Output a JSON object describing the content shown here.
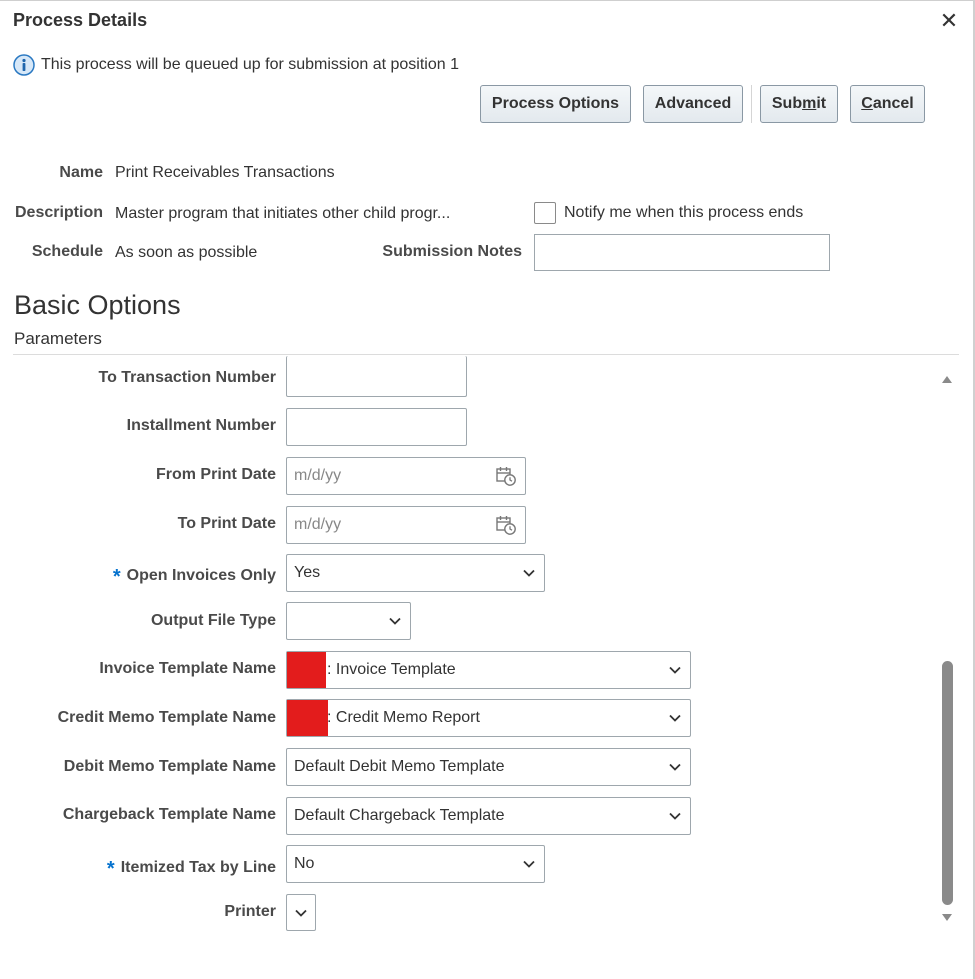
{
  "dialog": {
    "title": "Process Details",
    "info_text": "This process will be queued up for submission at position 1",
    "buttons": {
      "process_options": "Process Options",
      "advanced": "Advanced",
      "submit_pre": "Sub",
      "submit_mnemonic": "m",
      "submit_post": "it",
      "cancel_mnemonic": "C",
      "cancel_post": "ancel"
    }
  },
  "details": {
    "name_label": "Name",
    "name_value": "Print Receivables Transactions",
    "description_label": "Description",
    "description_value": "Master program that initiates other child progr...",
    "schedule_label": "Schedule",
    "schedule_value": "As soon as possible",
    "notify_label": "Notify me when this process ends",
    "notify_checked": false,
    "submission_notes_label": "Submission Notes",
    "submission_notes_value": ""
  },
  "sections": {
    "basic_options": "Basic Options",
    "parameters": "Parameters"
  },
  "parameters": {
    "to_transaction_number": {
      "label": "To Transaction Number",
      "value": ""
    },
    "installment_number": {
      "label": "Installment Number",
      "value": ""
    },
    "from_print_date": {
      "label": "From Print Date",
      "placeholder": "m/d/yy"
    },
    "to_print_date": {
      "label": "To Print Date",
      "placeholder": "m/d/yy"
    },
    "open_invoices_only": {
      "label": "Open Invoices Only",
      "required": "*",
      "value": "Yes"
    },
    "output_file_type": {
      "label": "Output File Type",
      "value": ""
    },
    "invoice_template_name": {
      "label": "Invoice Template Name",
      "value": ": Invoice Template"
    },
    "credit_memo_template_name": {
      "label": "Credit Memo Template Name",
      "value": ": Credit Memo Report"
    },
    "debit_memo_template_name": {
      "label": "Debit Memo Template Name",
      "value": "Default Debit Memo Template"
    },
    "chargeback_template_name": {
      "label": "Chargeback Template Name",
      "value": "Default Chargeback Template"
    },
    "itemized_tax_by_line": {
      "label": "Itemized Tax by Line",
      "required": "*",
      "value": "No"
    },
    "printer": {
      "label": "Printer",
      "value": ""
    }
  },
  "colors": {
    "required_marker": "#0572ce",
    "redaction": "#e31c1c",
    "button_border": "#8a98a4"
  },
  "icons": [
    "close-icon",
    "info-icon",
    "calendar-icon",
    "chevron-down-icon",
    "scroll-up-icon",
    "scroll-down-icon"
  ]
}
